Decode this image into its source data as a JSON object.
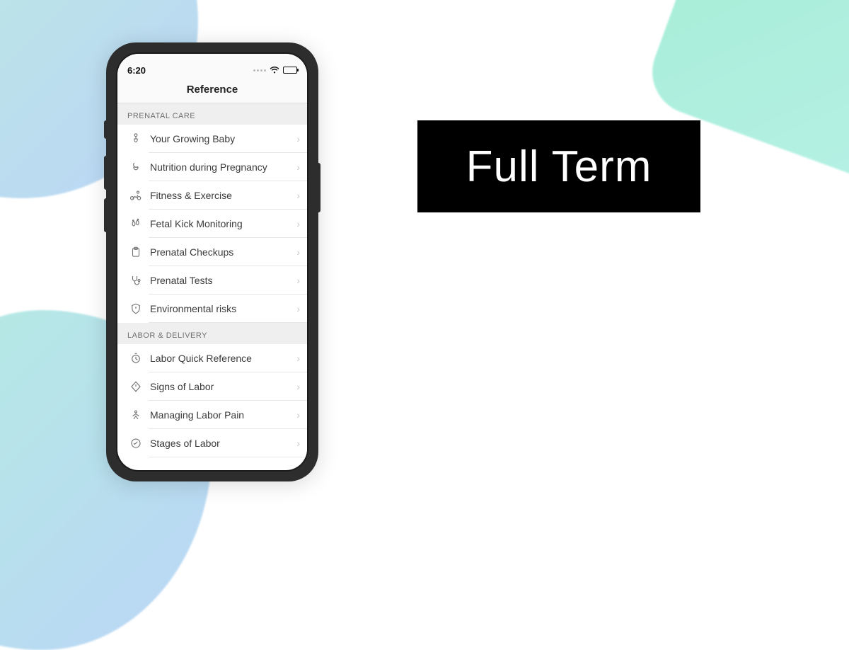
{
  "status": {
    "time": "6:20"
  },
  "nav": {
    "title": "Reference"
  },
  "sections": [
    {
      "header": "PRENATAL CARE",
      "items": [
        {
          "label": "Your Growing Baby",
          "icon": "baby-icon"
        },
        {
          "label": "Nutrition during Pregnancy",
          "icon": "nutrition-icon"
        },
        {
          "label": "Fitness & Exercise",
          "icon": "fitness-icon"
        },
        {
          "label": "Fetal Kick Monitoring",
          "icon": "footprints-icon"
        },
        {
          "label": "Prenatal Checkups",
          "icon": "clipboard-icon"
        },
        {
          "label": "Prenatal Tests",
          "icon": "stethoscope-icon"
        },
        {
          "label": "Environmental risks",
          "icon": "shield-warning-icon"
        }
      ]
    },
    {
      "header": "LABOR & DELIVERY",
      "items": [
        {
          "label": "Labor Quick Reference",
          "icon": "clock-icon"
        },
        {
          "label": "Signs of Labor",
          "icon": "diamond-warning-icon"
        },
        {
          "label": "Managing Labor Pain",
          "icon": "meditation-icon"
        },
        {
          "label": "Stages of Labor",
          "icon": "stages-icon"
        }
      ]
    }
  ],
  "app": {
    "name": "Full Term"
  }
}
